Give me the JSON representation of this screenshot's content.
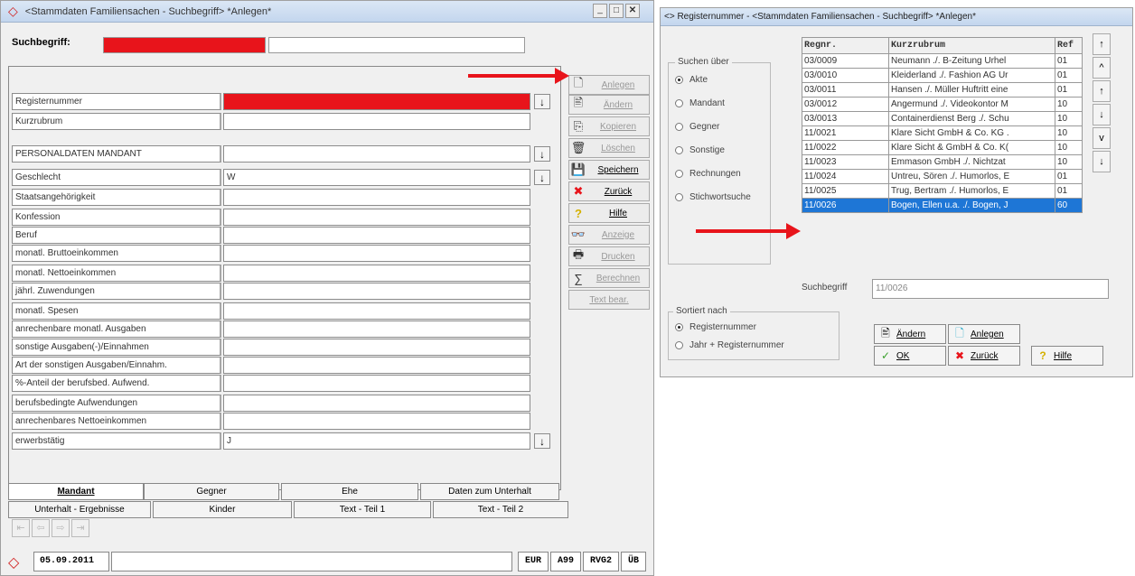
{
  "left": {
    "title": "<Stammdaten Familiensachen - Suchbegriff> *Anlegen*",
    "search_label": "Suchbegriff:",
    "fields": [
      {
        "label": "Registernummer",
        "value": "",
        "dropdown": true,
        "red": true
      },
      {
        "label": "Kurzrubrum",
        "value": "",
        "dropdown": false
      },
      {
        "label": "PERSONALDATEN MANDANT",
        "value": "",
        "dropdown": true
      },
      {
        "label": "Geschlecht",
        "value": "W",
        "dropdown": true
      },
      {
        "label": "Staatsangehörigkeit",
        "value": ""
      },
      {
        "label": "Konfession",
        "value": ""
      },
      {
        "label": "Beruf",
        "value": ""
      },
      {
        "label": "monatl. Bruttoeinkommen",
        "value": ""
      },
      {
        "label": "monatl. Nettoeinkommen",
        "value": ""
      },
      {
        "label": "jährl. Zuwendungen",
        "value": ""
      },
      {
        "label": "monatl. Spesen",
        "value": ""
      },
      {
        "label": "anrechenbare monatl. Ausgaben",
        "value": ""
      },
      {
        "label": "sonstige Ausgaben(-)/Einnahmen",
        "value": ""
      },
      {
        "label": "Art der sonstigen Ausgaben/Einnahm.",
        "value": ""
      },
      {
        "label": "%-Anteil der berufsbed. Aufwend.",
        "value": ""
      },
      {
        "label": "berufsbedingte Aufwendungen",
        "value": ""
      },
      {
        "label": "anrechenbares Nettoeinkommen",
        "value": ""
      },
      {
        "label": "erwerbstätig",
        "value": "J",
        "dropdown": true
      }
    ],
    "buttons": [
      {
        "label": "Anlegen",
        "icon": "new-document-icon",
        "glyph": "🗋",
        "enabled": false
      },
      {
        "label": "Ändern",
        "icon": "edit-document-icon",
        "glyph": "🖹",
        "enabled": false
      },
      {
        "label": "Kopieren",
        "icon": "copy-icon",
        "glyph": "⎘",
        "enabled": false
      },
      {
        "label": "Löschen",
        "icon": "trash-icon",
        "glyph": "🗑",
        "enabled": false
      },
      {
        "label": "Speichern",
        "icon": "save-icon",
        "glyph": "💾",
        "enabled": true
      },
      {
        "label": "Zurück",
        "icon": "red-x-icon",
        "glyph": "✖",
        "enabled": true
      },
      {
        "label": "Hilfe",
        "icon": "help-question-icon",
        "glyph": "?",
        "enabled": true
      },
      {
        "label": "Anzeige",
        "icon": "binoculars-icon",
        "glyph": "👓",
        "enabled": false
      },
      {
        "label": "Drucken",
        "icon": "printer-icon",
        "glyph": "🖶",
        "enabled": false
      },
      {
        "label": "Berechnen",
        "icon": "calculate-icon",
        "glyph": "∑",
        "enabled": false
      },
      {
        "label": "Text bear.",
        "icon": "",
        "glyph": "",
        "enabled": false
      }
    ],
    "tabs_row1": [
      "Mandant",
      "Gegner",
      "Ehe",
      "Daten zum Unterhalt"
    ],
    "tabs_row2": [
      "Unterhalt - Ergebnisse",
      "Kinder",
      "Text - Teil 1",
      "Text - Teil 2"
    ],
    "status": {
      "date": "05.09.2011",
      "cur": "EUR",
      "a": "A99",
      "rvg": "RVG2",
      "ub": "ÜB"
    }
  },
  "right": {
    "title": "<> Registernummer - <Stammdaten Familiensachen - Suchbegriff> *Anlegen*",
    "search_over_label": "Suchen über",
    "search_over": [
      "Akte",
      "Mandant",
      "Gegner",
      "Sonstige",
      "Rechnungen",
      "Stichwortsuche"
    ],
    "columns": [
      "Regnr.",
      "Kurzrubrum",
      "Ref"
    ],
    "rows": [
      [
        "03/0009",
        "Neumann ./. B-Zeitung Urhel",
        "01"
      ],
      [
        "03/0010",
        "Kleiderland ./. Fashion AG Ur",
        "01"
      ],
      [
        "03/0011",
        "Hansen ./. Müller Huftritt eine",
        "01"
      ],
      [
        "03/0012",
        "Angermund ./. Videokontor M",
        "10"
      ],
      [
        "03/0013",
        "Containerdienst Berg ./. Schu",
        "10"
      ],
      [
        "11/0021",
        "Klare Sicht GmbH & Co. KG .",
        "10"
      ],
      [
        "11/0022",
        "Klare Sicht & GmbH & Co. K(",
        "10"
      ],
      [
        "11/0023",
        "Emmason GmbH ./. Nichtzat",
        "10"
      ],
      [
        "11/0024",
        "Untreu, Sören ./. Humorlos, E",
        "01"
      ],
      [
        "11/0025",
        "Trug, Bertram ./. Humorlos, E",
        "01"
      ],
      [
        "11/0026",
        "Bogen, Ellen u.a. ./. Bogen, J",
        "60"
      ]
    ],
    "suchbegriff_label": "Suchbegriff",
    "suchbegriff_value": "11/0026",
    "sort_label": "Sortiert nach",
    "sort_options": [
      "Registernummer",
      "Jahr + Registernummer"
    ],
    "btn_aendern": "Ändern",
    "btn_anlegen": "Anlegen",
    "btn_ok": "OK",
    "btn_zurueck": "Zurück",
    "btn_hilfe": "Hilfe"
  },
  "colors": {
    "red": "#e8141b",
    "select": "#1e76d6"
  }
}
